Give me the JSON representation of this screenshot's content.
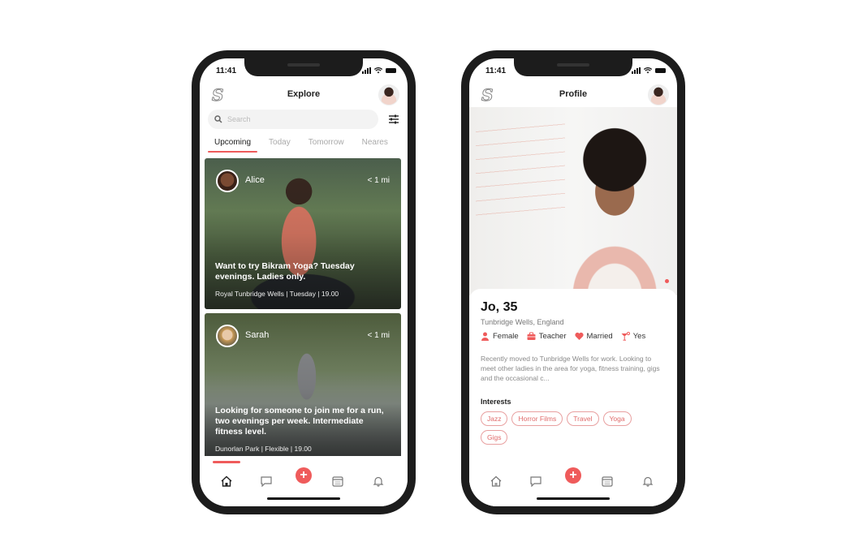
{
  "theme": {
    "accent": "#ef5b5b",
    "frame": "#1c1c1c"
  },
  "explore_screen": {
    "status_time": "11:41",
    "header": {
      "title": "Explore"
    },
    "search": {
      "placeholder": "Search"
    },
    "tabs": [
      {
        "label": "Upcoming",
        "active": true
      },
      {
        "label": "Today",
        "active": false
      },
      {
        "label": "Tomorrow",
        "active": false
      },
      {
        "label": "Neares",
        "active": false
      }
    ],
    "cards": [
      {
        "name": "Alice",
        "distance": "< 1 mi",
        "title": "Want to try Bikram Yoga? Tuesday evenings. Ladies only.",
        "meta": "Royal Tunbridge Wells | Tuesday | 19.00"
      },
      {
        "name": "Sarah",
        "distance": "< 1 mi",
        "title": "Looking for someone to join me for a run, two evenings per week. Intermediate fitness level.",
        "meta": "Dunorlan Park | Flexible | 19.00"
      }
    ],
    "bottom_nav": {
      "items": [
        "home-icon",
        "chat-icon",
        "add-icon",
        "calendar-icon",
        "bell-icon"
      ],
      "active": "home-icon",
      "fab_label": "+"
    }
  },
  "profile_screen": {
    "status_time": "11:41",
    "header": {
      "title": "Profile"
    },
    "profile": {
      "name_age": "Jo, 35",
      "location": "Tunbridge Wells, England",
      "attributes": [
        {
          "icon": "person-icon",
          "label": "Female"
        },
        {
          "icon": "briefcase-icon",
          "label": "Teacher"
        },
        {
          "icon": "heart-icon",
          "label": "Married"
        },
        {
          "icon": "cocktail-icon",
          "label": "Yes"
        }
      ],
      "bio": "Recently moved to Tunbridge Wells for work. Looking to meet other ladies in the area for yoga, fitness training, gigs and the occasional c...",
      "interests_heading": "Interests",
      "interests": [
        "Jazz",
        "Horror Films",
        "Travel",
        "Yoga",
        "Gigs"
      ]
    },
    "bottom_nav": {
      "items": [
        "home-icon",
        "chat-icon",
        "add-icon",
        "calendar-icon",
        "bell-icon"
      ],
      "fab_label": "+"
    }
  }
}
